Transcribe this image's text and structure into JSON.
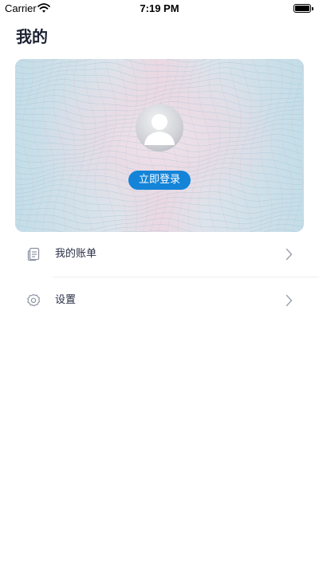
{
  "status_bar": {
    "carrier": "Carrier",
    "time": "7:19 PM"
  },
  "page": {
    "title": "我的"
  },
  "profile_card": {
    "avatar_icon": "default-user-avatar",
    "login_label": "立即登录",
    "login_color": "#1484d8"
  },
  "menu": {
    "items": [
      {
        "label": "我的账单",
        "icon": "bill-document-icon"
      },
      {
        "label": "设置",
        "icon": "gear-icon"
      }
    ]
  }
}
